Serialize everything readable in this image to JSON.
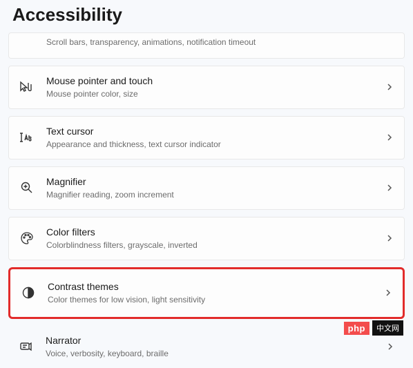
{
  "page_title": "Accessibility",
  "items": [
    {
      "title": "",
      "subtitle": "Scroll bars, transparency, animations, notification timeout"
    },
    {
      "title": "Mouse pointer and touch",
      "subtitle": "Mouse pointer color, size"
    },
    {
      "title": "Text cursor",
      "subtitle": "Appearance and thickness, text cursor indicator"
    },
    {
      "title": "Magnifier",
      "subtitle": "Magnifier reading, zoom increment"
    },
    {
      "title": "Color filters",
      "subtitle": "Colorblindness filters, grayscale, inverted"
    },
    {
      "title": "Contrast themes",
      "subtitle": "Color themes for low vision, light sensitivity"
    },
    {
      "title": "Narrator",
      "subtitle": "Voice, verbosity, keyboard, braille"
    }
  ],
  "watermark": {
    "left": "php",
    "right": "中文网"
  }
}
